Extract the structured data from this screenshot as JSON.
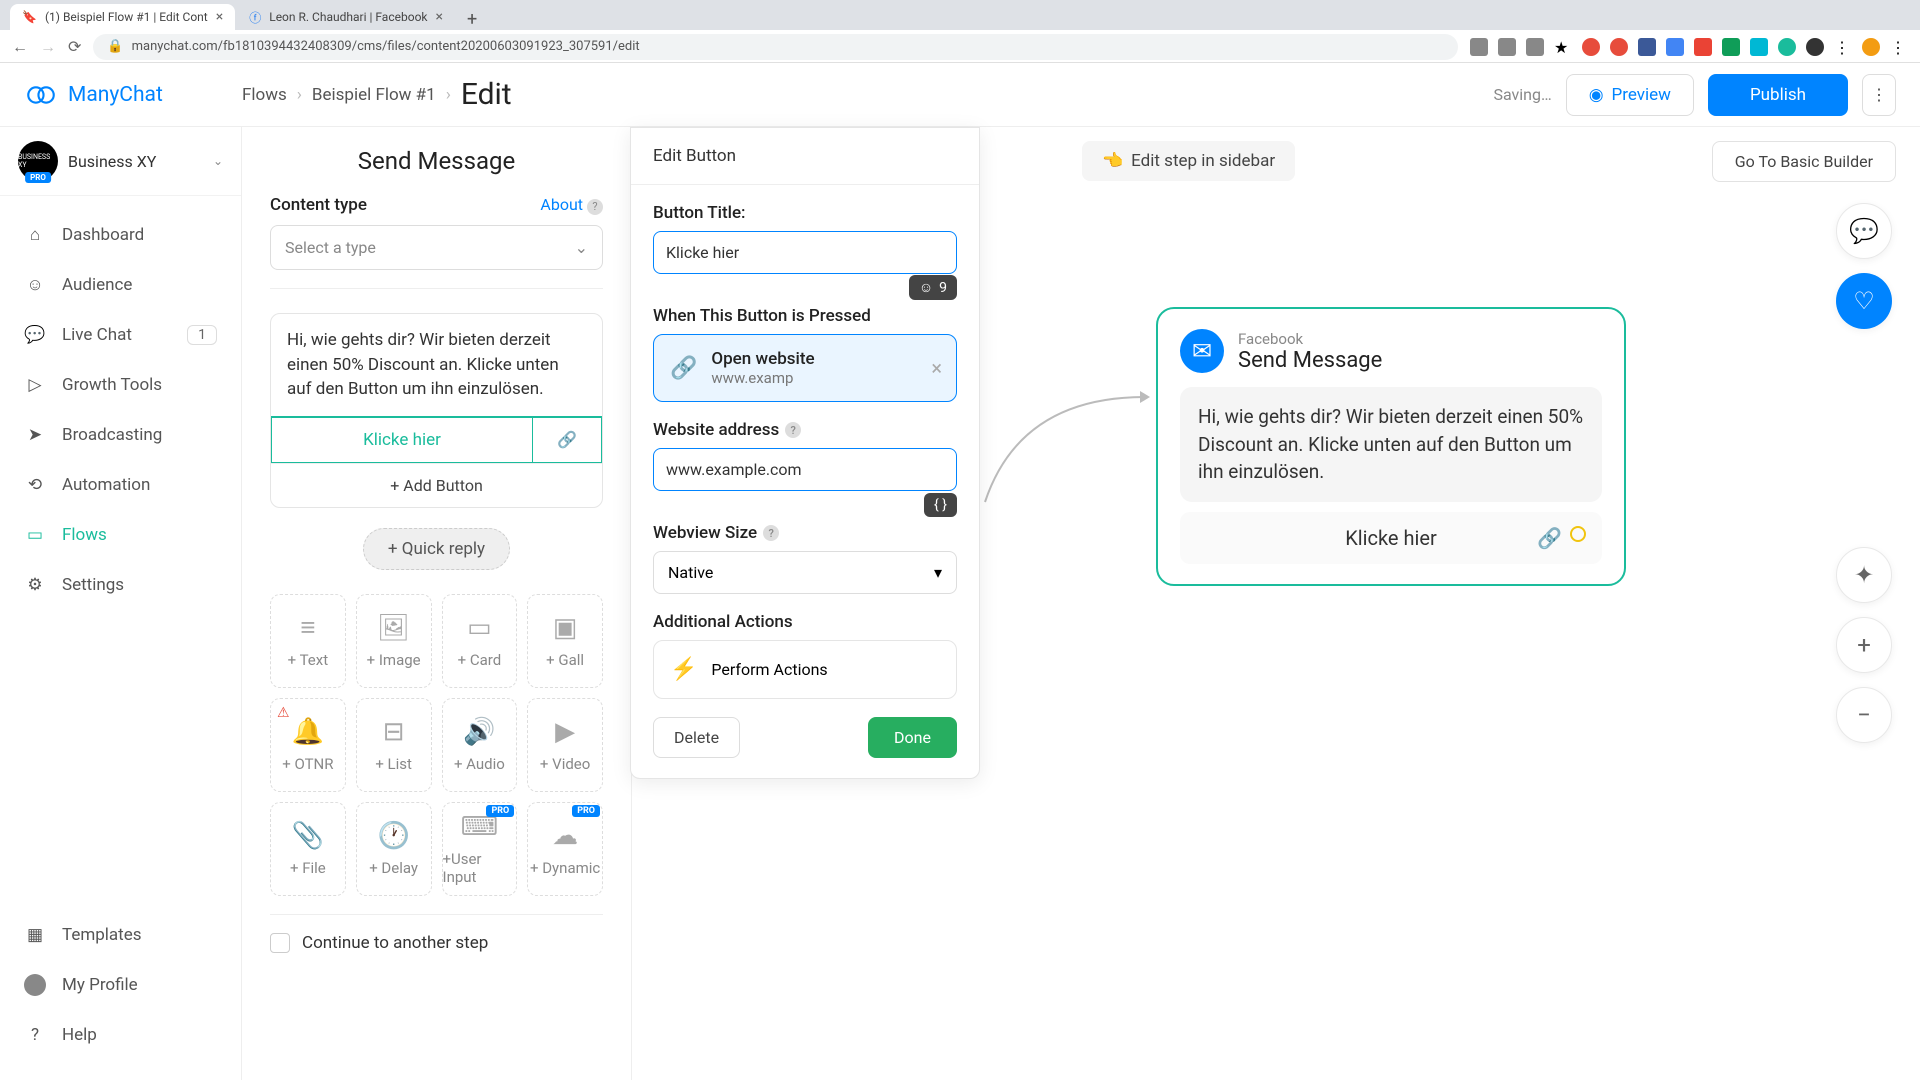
{
  "browser": {
    "tabs": [
      {
        "title": "(1) Beispiel Flow #1 | Edit Cont",
        "active": true
      },
      {
        "title": "Leon R. Chaudhari | Facebook",
        "active": false
      }
    ],
    "url": "manychat.com/fb181039443240830​9/cms/files/content20200603091923_307591/edit"
  },
  "brand": "ManyChat",
  "breadcrumb": {
    "flows": "Flows",
    "flow_name": "Beispiel Flow #1",
    "edit": "Edit"
  },
  "header": {
    "saving": "Saving…",
    "preview": "Preview",
    "publish": "Publish"
  },
  "workspace": {
    "name": "Business XY",
    "badge": "PRO"
  },
  "sidebar": {
    "items": [
      {
        "label": "Dashboard"
      },
      {
        "label": "Audience"
      },
      {
        "label": "Live Chat",
        "badge": "1"
      },
      {
        "label": "Growth Tools"
      },
      {
        "label": "Broadcasting"
      },
      {
        "label": "Automation"
      },
      {
        "label": "Flows",
        "active": true
      },
      {
        "label": "Settings"
      }
    ],
    "bottom": [
      {
        "label": "Templates"
      },
      {
        "label": "My Profile"
      },
      {
        "label": "Help"
      }
    ]
  },
  "editor": {
    "title": "Send Message",
    "content_type_label": "Content type",
    "about": "About",
    "select_placeholder": "Select a type",
    "message_text": "Hi, wie gehts dir? Wir bieten derzeit einen 50% Discount an. Klicke unten auf den Button um ihn einzulösen.",
    "button_label": "Klicke hier",
    "add_button": "+ Add Button",
    "quick_reply": "+ Quick reply",
    "blocks": [
      "+ Text",
      "+ Image",
      "+ Card",
      "+ Gall",
      "+ OTNR",
      "+ List",
      "+ Audio",
      "+ Video",
      "+ File",
      "+ Delay",
      "+User Input",
      "+ Dynamic"
    ],
    "pro_badge": "PRO",
    "continue": "Continue to another step"
  },
  "popup": {
    "title": "Edit Button",
    "button_title_label": "Button Title:",
    "button_title_value": "Klicke hier",
    "char_count": "9",
    "when_pressed": "When This Button is Pressed",
    "action_title": "Open website",
    "action_sub": "www.examp",
    "website_label": "Website address",
    "website_value": "www.example.com",
    "variable_badge": "{ }",
    "webview_label": "Webview Size",
    "webview_value": "Native",
    "additional": "Additional Actions",
    "perform": "Perform Actions",
    "delete": "Delete",
    "done": "Done"
  },
  "canvas": {
    "edit_step": "Edit step in sidebar",
    "go_basic": "Go To Basic Builder",
    "node": {
      "platform": "Facebook",
      "title": "Send Message",
      "message": "Hi, wie gehts dir? Wir bieten derzeit einen 50% Discount an. Klicke unten auf den Button um ihn einzulösen.",
      "button": "Klicke hier"
    }
  }
}
